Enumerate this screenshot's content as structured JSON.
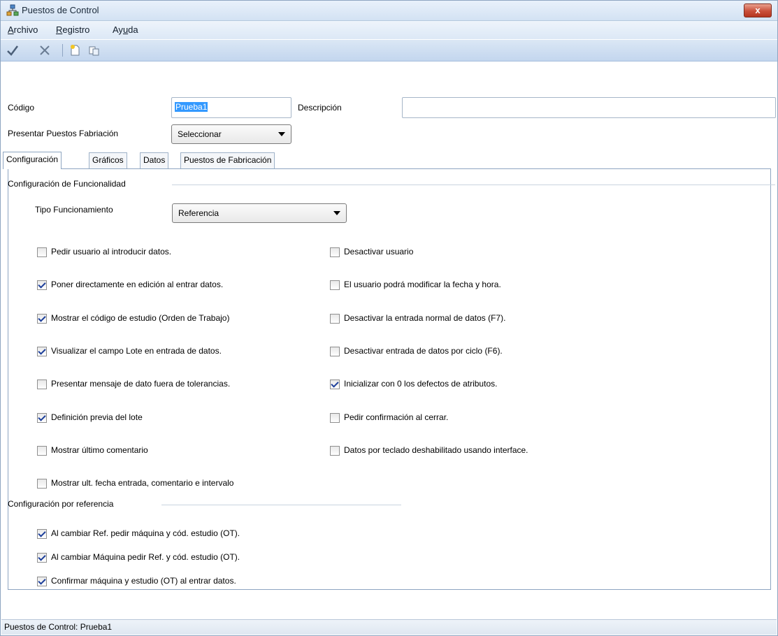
{
  "window": {
    "title": "Puestos de Control",
    "close_label": "x"
  },
  "menu": {
    "items": [
      {
        "label": "Archivo",
        "underline": "A",
        "rest": "rchivo"
      },
      {
        "label": "Registro",
        "underline": "R",
        "rest": "egistro"
      },
      {
        "label": "Ayuda",
        "pre": "Ay",
        "underline": "u",
        "rest": "da"
      }
    ]
  },
  "toolbar": {
    "buttons": [
      "accept-check-icon",
      "cancel-x-icon",
      "new-document-icon",
      "copy-icon"
    ]
  },
  "form": {
    "codigo_label": "Código",
    "codigo_value": "Prueba1",
    "descripcion_label": "Descripción",
    "descripcion_value": "",
    "presentar_label": "Presentar Puestos Fabriación",
    "presentar_value": "Seleccionar"
  },
  "tabs": [
    "Configuración",
    "Gráficos",
    "Datos",
    "Puestos de Fabricación"
  ],
  "config": {
    "group1_title": "Configuración de Funcionalidad",
    "tipo_label": "Tipo Funcionamiento",
    "tipo_value": "Referencia",
    "left_options": [
      {
        "label": "Pedir usuario al introducir datos.",
        "checked": false
      },
      {
        "label": "Poner directamente en edición al entrar datos.",
        "checked": true
      },
      {
        "label": "Mostrar el código de estudio (Orden de Trabajo)",
        "checked": true
      },
      {
        "label": "Visualizar el campo Lote en entrada de datos.",
        "checked": true
      },
      {
        "label": "Presentar mensaje de dato fuera de tolerancias.",
        "checked": false
      },
      {
        "label": "Definición previa del lote",
        "checked": true
      },
      {
        "label": "Mostrar último comentario",
        "checked": false
      },
      {
        "label": "Mostrar ult. fecha entrada, comentario e intervalo",
        "checked": false
      }
    ],
    "right_options": [
      {
        "label": "Desactivar usuario",
        "checked": false
      },
      {
        "label": "El usuario podrá modificar la fecha y hora.",
        "checked": false
      },
      {
        "label": "Desactivar la entrada normal de datos (F7).",
        "checked": false
      },
      {
        "label": "Desactivar entrada de datos por ciclo (F6).",
        "checked": false
      },
      {
        "label": "Inicializar con 0 los defectos de atributos.",
        "checked": true
      },
      {
        "label": "Pedir confirmación al cerrar.",
        "checked": false
      },
      {
        "label": "Datos por teclado deshabilitado usando interface.",
        "checked": false
      }
    ],
    "group2_title": "Configuración por referencia",
    "ref_options": [
      {
        "label": "Al cambiar Ref. pedir máquina y cód. estudio (OT).",
        "checked": true
      },
      {
        "label": "Al cambiar Máquina pedir Ref. y cód. estudio (OT).",
        "checked": true
      },
      {
        "label": "Confirmar máquina y estudio (OT) al entrar datos.",
        "checked": true
      }
    ]
  },
  "status": {
    "text": "Puestos de Control: Prueba1"
  }
}
